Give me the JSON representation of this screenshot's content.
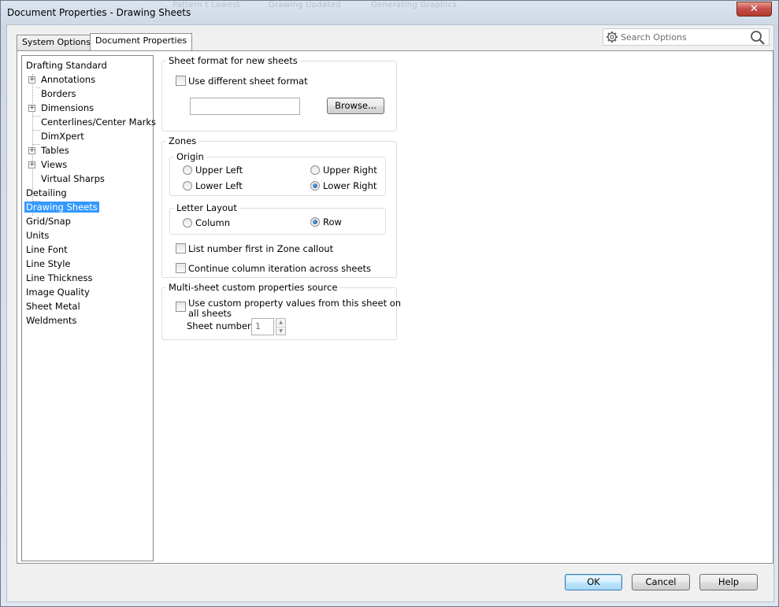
{
  "window": {
    "title": "Document Properties - Drawing Sheets",
    "close_label": "✕",
    "background_labels": [
      "Pattern t Lowest",
      "Drawing Updated",
      "Generating Graphics"
    ]
  },
  "tabs": [
    {
      "label": "System Options",
      "active": false
    },
    {
      "label": "Document Properties",
      "active": true
    }
  ],
  "search": {
    "placeholder": "Search Options"
  },
  "tree": {
    "items": [
      {
        "label": "Drafting Standard",
        "level": 0,
        "expandable": false
      },
      {
        "label": "Annotations",
        "level": 1,
        "expandable": true
      },
      {
        "label": "Borders",
        "level": 1,
        "expandable": false
      },
      {
        "label": "Dimensions",
        "level": 1,
        "expandable": true
      },
      {
        "label": "Centerlines/Center Marks",
        "level": 1,
        "expandable": false
      },
      {
        "label": "DimXpert",
        "level": 1,
        "expandable": false
      },
      {
        "label": "Tables",
        "level": 1,
        "expandable": true
      },
      {
        "label": "Views",
        "level": 1,
        "expandable": true
      },
      {
        "label": "Virtual Sharps",
        "level": 1,
        "expandable": false
      },
      {
        "label": "Detailing",
        "level": 0,
        "expandable": false
      },
      {
        "label": "Drawing Sheets",
        "level": 0,
        "expandable": false,
        "selected": true
      },
      {
        "label": "Grid/Snap",
        "level": 0,
        "expandable": false
      },
      {
        "label": "Units",
        "level": 0,
        "expandable": false
      },
      {
        "label": "Line Font",
        "level": 0,
        "expandable": false
      },
      {
        "label": "Line Style",
        "level": 0,
        "expandable": false
      },
      {
        "label": "Line Thickness",
        "level": 0,
        "expandable": false
      },
      {
        "label": "Image Quality",
        "level": 0,
        "expandable": false
      },
      {
        "label": "Sheet Metal",
        "level": 0,
        "expandable": false
      },
      {
        "label": "Weldments",
        "level": 0,
        "expandable": false
      }
    ]
  },
  "sheet_format": {
    "title": "Sheet format for new sheets",
    "use_different_label": "Use different sheet format",
    "use_different_checked": false,
    "path_value": "",
    "browse_label": "Browse..."
  },
  "zones": {
    "title": "Zones",
    "origin": {
      "title": "Origin",
      "upper_left": "Upper Left",
      "upper_right": "Upper Right",
      "lower_left": "Lower Left",
      "lower_right": "Lower Right",
      "selected": "Lower Right"
    },
    "letter_layout": {
      "title": "Letter Layout",
      "column": "Column",
      "row": "Row",
      "selected": "Row"
    },
    "list_number_first_label": "List number first in Zone callout",
    "continue_column_label": "Continue column iteration across sheets"
  },
  "multi_sheet": {
    "title": "Multi-sheet custom properties source",
    "use_custom_label_line1": "Use custom property values from this sheet on",
    "use_custom_label_line2": "all sheets",
    "sheet_number_label": "Sheet number:",
    "sheet_number_value": "1"
  },
  "buttons": {
    "ok": "OK",
    "cancel": "Cancel",
    "help": "Help"
  }
}
